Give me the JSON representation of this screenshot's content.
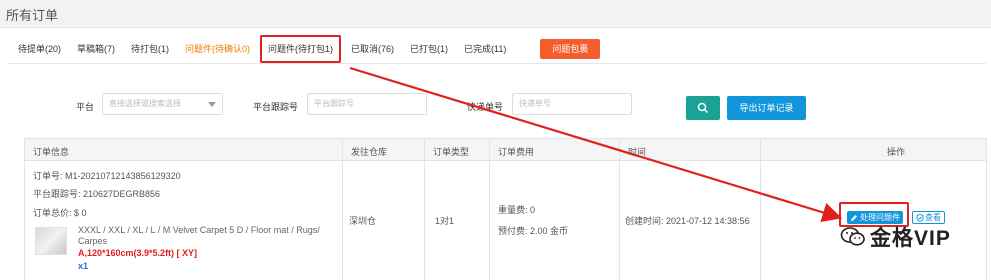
{
  "header": {
    "title": "所有订单"
  },
  "tabs": [
    {
      "label": "待提单(20)"
    },
    {
      "label": "草稿箱(7)"
    },
    {
      "label": "待打包(1)"
    },
    {
      "label": "问题件(待确认0)"
    },
    {
      "label": "问题件(待打包1)"
    },
    {
      "label": "已取消(76)"
    },
    {
      "label": "已打包(1)"
    },
    {
      "label": "已完成(11)"
    }
  ],
  "problem_button": "问题包裹",
  "filters": {
    "platform_label": "平台",
    "platform_placeholder": "直接选择或搜索选择",
    "tracking_label": "平台跟踪号",
    "tracking_placeholder": "平台跟踪号",
    "express_label": "快递单号",
    "express_placeholder": "快递单号",
    "export_label": "导出订单记录"
  },
  "table": {
    "headers": {
      "order_info": "订单信息",
      "warehouse": "发往仓库",
      "type": "订单类型",
      "fee": "订单费用",
      "time": "时间",
      "action": "操作"
    },
    "row": {
      "order_no": "订单号: M1-20210712143856129320",
      "tracking_no": "平台跟踪号: 210627DEGRB856",
      "total": "订单总价: $ 0",
      "product_name": "XXXL / XXL / XL / L / M Velvet Carpet 5 D / Floor mat / Rugs/ Carpes",
      "product_spec": "A,120*160cm(3.9*5.2ft) [ XY]",
      "product_qty": "x1",
      "warehouse": "深圳仓",
      "type": "1对1",
      "weight_fee": "重量费: 0",
      "prepaid_fee": "预付费: 2.00 金币",
      "created_time": "创建时间: 2021-07-12 14:38:56",
      "handle_label": "处理问题件",
      "view_label": "查看"
    }
  },
  "watermark": "金格VIP",
  "colors": {
    "orange": "#f45d2c",
    "teal": "#1aa394",
    "blue": "#1296db",
    "highlight_red": "#e02020"
  }
}
